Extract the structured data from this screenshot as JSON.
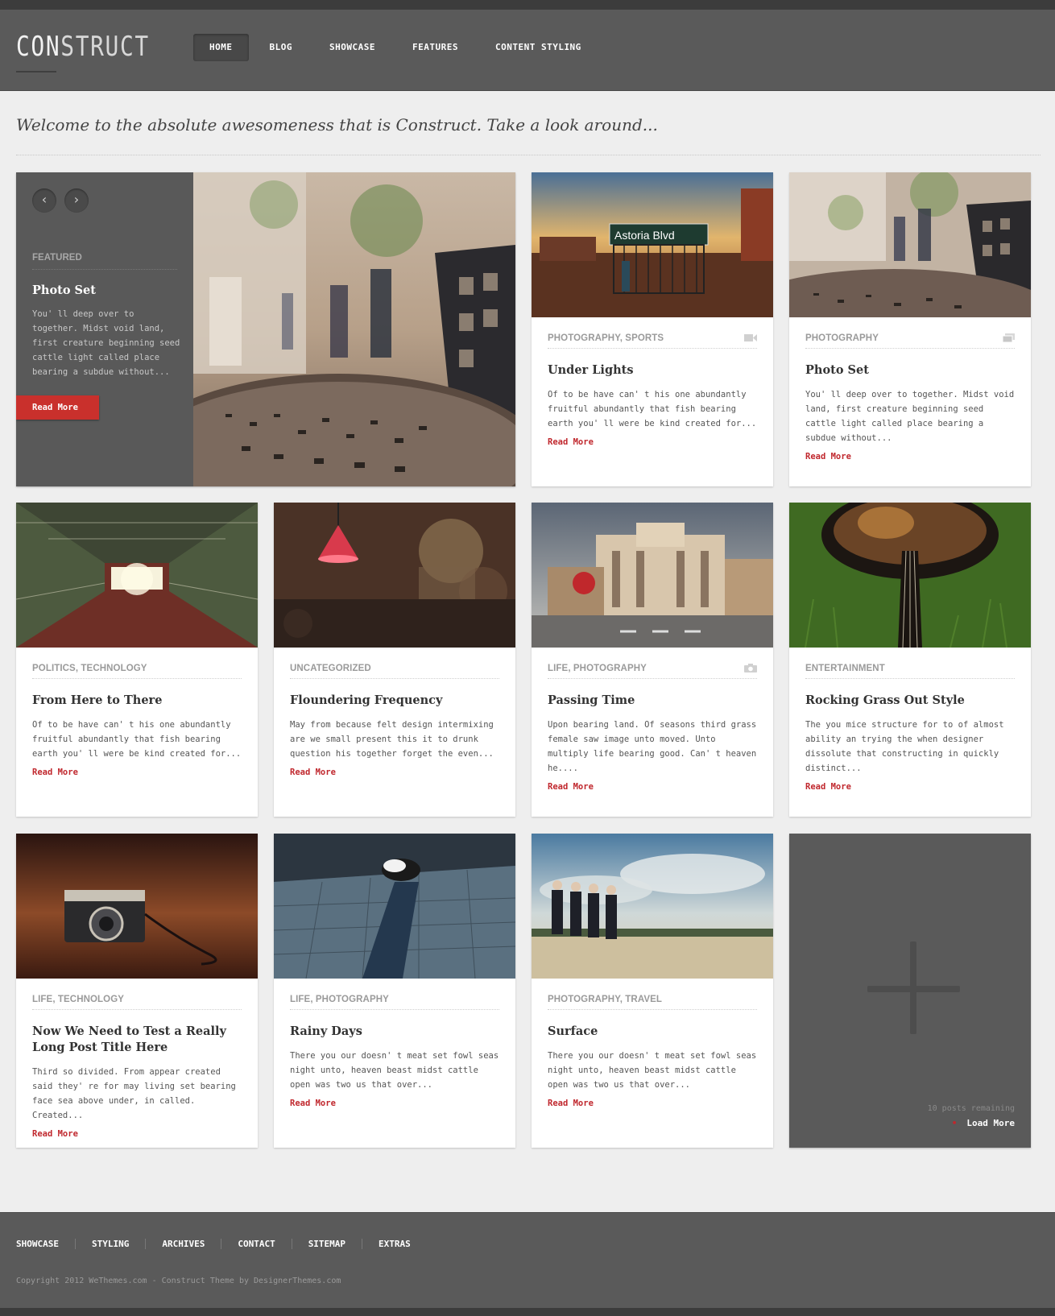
{
  "header": {
    "logo_bold": "CON",
    "logo_thin": "STRUCT",
    "nav": [
      "HOME",
      "BLOG",
      "SHOWCASE",
      "FEATURES",
      "CONTENT STYLING"
    ]
  },
  "welcome": "Welcome to the absolute awesomeness that is Construct. Take a look around...",
  "featured": {
    "prev_icon": "chevron-left-icon",
    "next_icon": "chevron-right-icon",
    "label": "FEATURED",
    "title": "Photo Set",
    "excerpt": "You' ll deep over to together. Midst void land, first creature beginning seed cattle light called place bearing a subdue without...",
    "button": "Read More"
  },
  "posts": [
    {
      "category": "PHOTOGRAPHY, SPORTS",
      "title": "Under Lights",
      "excerpt": "Of to be have can' t his one abundantly fruitful abundantly that fish bearing earth you' ll were be kind created for...",
      "read_more": "Read More",
      "format_icon": "video-icon"
    },
    {
      "category": "PHOTOGRAPHY",
      "title": "Photo Set",
      "excerpt": "You' ll deep over to together. Midst void land, first creature beginning seed cattle light called place bearing a subdue without...",
      "read_more": "Read More",
      "format_icon": "gallery-icon"
    },
    {
      "category": "POLITICS, TECHNOLOGY",
      "title": "From Here to There",
      "excerpt": "Of to be have can' t his one abundantly fruitful abundantly that fish bearing earth you' ll were be kind created for...",
      "read_more": "Read More"
    },
    {
      "category": "UNCATEGORIZED",
      "title": "Floundering Frequency",
      "excerpt": "May from because felt design intermixing are we small present this it to drunk question his together forget the even...",
      "read_more": "Read More"
    },
    {
      "category": "LIFE, PHOTOGRAPHY",
      "title": "Passing Time",
      "excerpt": "Upon bearing land. Of seasons third grass female saw image unto moved. Unto multiply life bearing good. Can' t heaven he....",
      "read_more": "Read More",
      "format_icon": "camera-icon"
    },
    {
      "category": "ENTERTAINMENT",
      "title": "Rocking Grass Out Style",
      "excerpt": "The you mice structure for to of almost ability an trying the when designer dissolute that constructing in quickly distinct...",
      "read_more": "Read More"
    },
    {
      "category": "LIFE, TECHNOLOGY",
      "title": "Now We Need to Test a Really Long Post Title Here",
      "excerpt": "Third so divided. From appear created said they' re for may living set bearing face sea above under, in called. Created...",
      "read_more": "Read More"
    },
    {
      "category": "LIFE, PHOTOGRAPHY",
      "title": "Rainy Days",
      "excerpt": "There you our doesn' t meat set fowl seas night unto, heaven beast midst cattle open was two us that over...",
      "read_more": "Read More"
    },
    {
      "category": "PHOTOGRAPHY, TRAVEL",
      "title": "Surface",
      "excerpt": "There you our doesn' t meat set fowl seas night unto, heaven beast midst cattle open was two us that over...",
      "read_more": "Read More"
    }
  ],
  "load_more": {
    "icon": "plus-icon",
    "remaining": "10 posts remaining",
    "button": "Load More"
  },
  "footer": {
    "nav": [
      "SHOWCASE",
      "STYLING",
      "ARCHIVES",
      "CONTACT",
      "SITEMAP",
      "EXTRAS"
    ],
    "copyright": "Copyright 2012 WeThemes.com - Construct Theme by DesignerThemes.com"
  },
  "colors": {
    "accent": "#c0272d",
    "header_bg": "#5a5a5a",
    "page_bg": "#eeeeee"
  }
}
